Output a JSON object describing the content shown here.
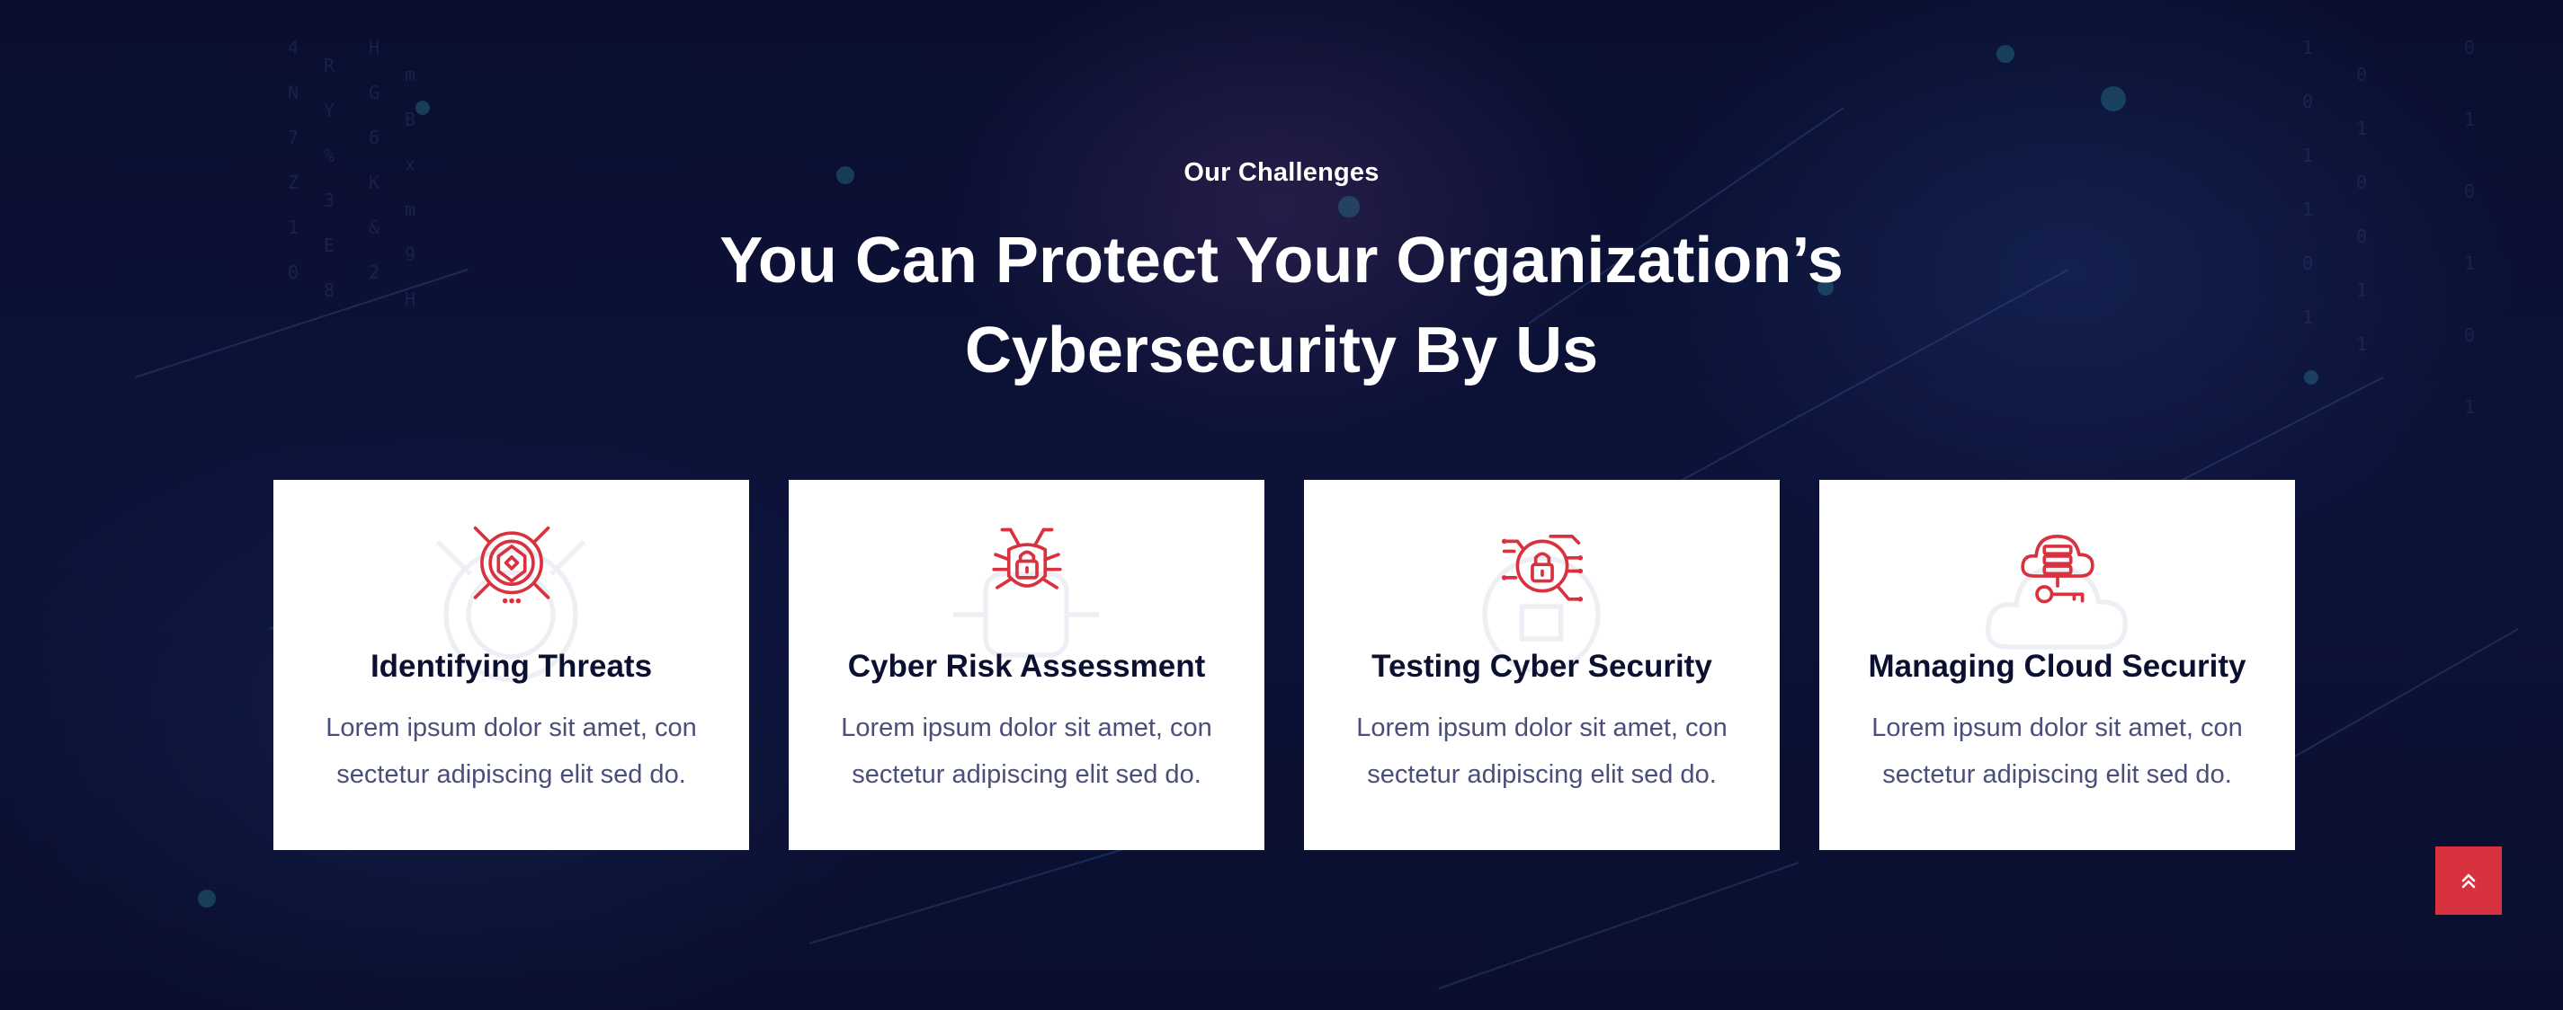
{
  "section": {
    "eyebrow": "Our Challenges",
    "headline": "You Can Protect Your Organization’s Cybersecurity By Us"
  },
  "colors": {
    "accent": "#d8323f",
    "background": "#0b1034",
    "card_background": "#ffffff",
    "title_text": "#0b1030",
    "body_text": "#4a4f7a"
  },
  "cards": [
    {
      "icon": "target-shield-icon",
      "title": "Identifying Threats",
      "text": "Lorem ipsum dolor sit amet, con sectetur adipiscing elit sed do."
    },
    {
      "icon": "bug-lock-icon",
      "title": "Cyber Risk Assessment",
      "text": "Lorem ipsum dolor sit amet, con sectetur adipiscing elit sed do."
    },
    {
      "icon": "circuit-lock-icon",
      "title": "Testing Cyber Security",
      "text": "Lorem ipsum dolor sit amet, con sectetur adipiscing elit sed do."
    },
    {
      "icon": "cloud-key-icon",
      "title": "Managing Cloud Security",
      "text": "Lorem ipsum dolor sit amet, con sectetur adipiscing elit sed do."
    }
  ],
  "scroll_top": {
    "icon": "double-chevron-up-icon"
  }
}
